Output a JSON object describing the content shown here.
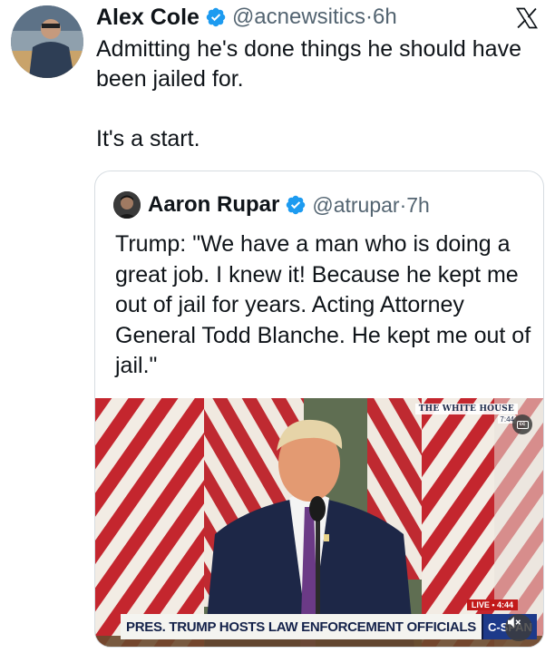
{
  "tweet": {
    "author_name": "Alex Cole",
    "handle": "@acnewsitics",
    "separator": "·",
    "time": "6h",
    "text": "Admitting he's done things he should have been jailed for.\n\nIt's a start."
  },
  "quote": {
    "author_name": "Aaron Rupar",
    "handle": "@atrupar",
    "separator": "·",
    "time": "7h",
    "text": "Trump: \"We have a man who is doing a great job. I knew it! Because he kept me out of jail for years. Acting Attorney General Todd Blanche. He kept me out of jail.\""
  },
  "video": {
    "network_bug": "THE WHITE HOUSE",
    "bug_time": "7:44",
    "live_label": "LIVE • 4:44",
    "chyron": "PRES. TRUMP HOSTS LAW ENFORCEMENT OFFICIALS",
    "brand": "C-SPAN",
    "icons": [
      "captions-icon",
      "mute-icon"
    ]
  },
  "icons": [
    "verified-badge-icon",
    "x-logo-icon"
  ],
  "colors": {
    "text": "#0f1419",
    "secondary": "#536471",
    "verified": "#1d9bf0",
    "border": "#d6dce1"
  }
}
